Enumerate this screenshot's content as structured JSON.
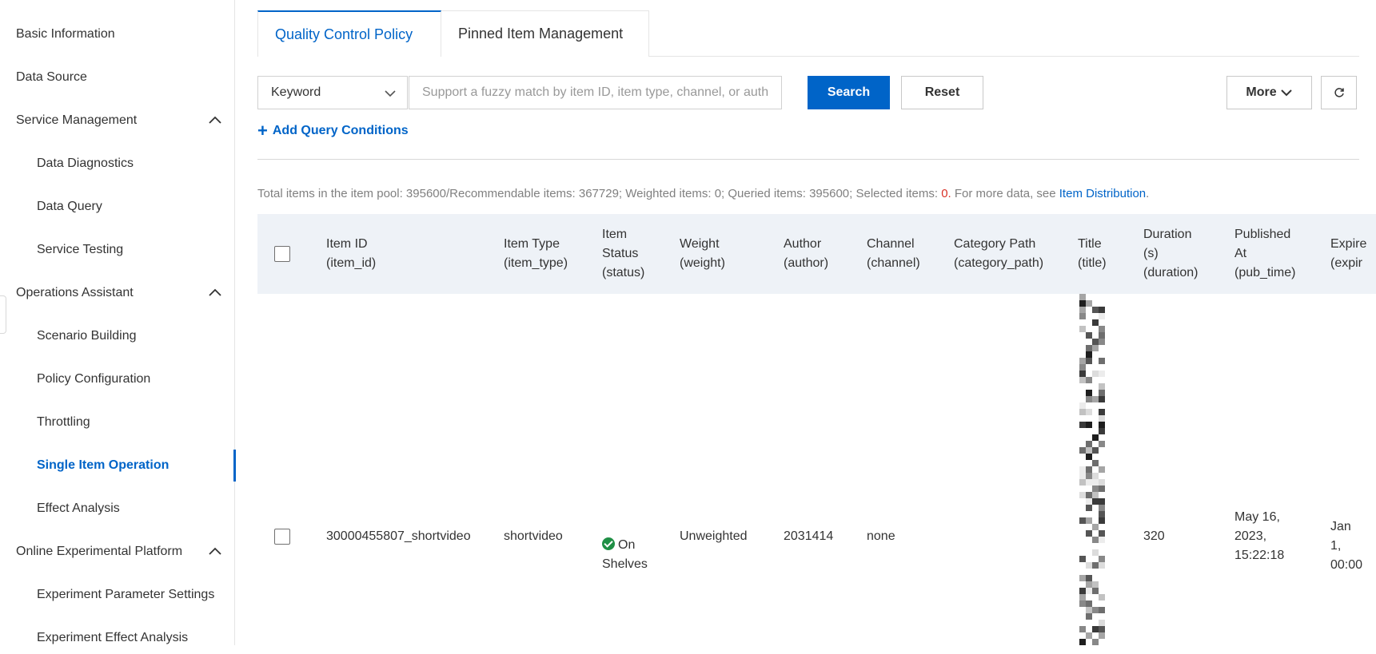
{
  "sidebar": {
    "items": [
      {
        "label": "Basic Information"
      },
      {
        "label": "Data Source"
      },
      {
        "label": "Service Management"
      },
      {
        "label": "Data Diagnostics"
      },
      {
        "label": "Data Query"
      },
      {
        "label": "Service Testing"
      },
      {
        "label": "Operations Assistant"
      },
      {
        "label": "Scenario Building"
      },
      {
        "label": "Policy Configuration"
      },
      {
        "label": "Throttling"
      },
      {
        "label": "Single Item Operation"
      },
      {
        "label": "Effect Analysis"
      },
      {
        "label": "Online Experimental Platform"
      },
      {
        "label": "Experiment Parameter Settings"
      },
      {
        "label": "Experiment Effect Analysis"
      }
    ],
    "active_item": "Single Item Operation"
  },
  "tabs": [
    {
      "label": "Quality Control Policy",
      "active": true
    },
    {
      "label": "Pinned Item Management",
      "active": false
    }
  ],
  "filter": {
    "field_select": "Keyword",
    "search_placeholder": "Support a fuzzy match by item ID, item type, channel, or author",
    "search_value": "",
    "search_button": "Search",
    "reset_button": "Reset",
    "more_button": "More",
    "add_conditions": "Add Query Conditions"
  },
  "summary": {
    "text": "Total items in the item pool: 395600/Recommendable items: 367729; Weighted items: 0; Queried items: 395600; Selected items: ",
    "selected": "0.",
    "more_text": " For more data, see ",
    "link": "Item Distribution",
    "end": "."
  },
  "table": {
    "columns": [
      "Item ID\n(item_id)",
      "Item Type\n(item_type)",
      "Item\nStatus\n(status)",
      "Weight\n(weight)",
      "Author\n(author)",
      "Channel\n(channel)",
      "Category Path\n(category_path)",
      "Title\n(title)",
      "Duration\n(s)\n(duration)",
      "Published\nAt\n(pub_time)",
      "Expire\n(expir"
    ],
    "rows": [
      {
        "item_id": "30000455807_shortvideo",
        "item_type": "shortvideo",
        "status": "On\nShelves",
        "weight": "Unweighted",
        "author": "2031414",
        "channel": "none",
        "category_path": "",
        "duration": "320",
        "pub_time": "May 16,\n2023,\n15:22:18",
        "expire": "Jan 1,\n00:00"
      }
    ]
  },
  "colors": {
    "accent": "#0064c8",
    "status_green": "#1f8f45",
    "alert_red": "#d93026",
    "header_bg": "#eef2f7"
  }
}
